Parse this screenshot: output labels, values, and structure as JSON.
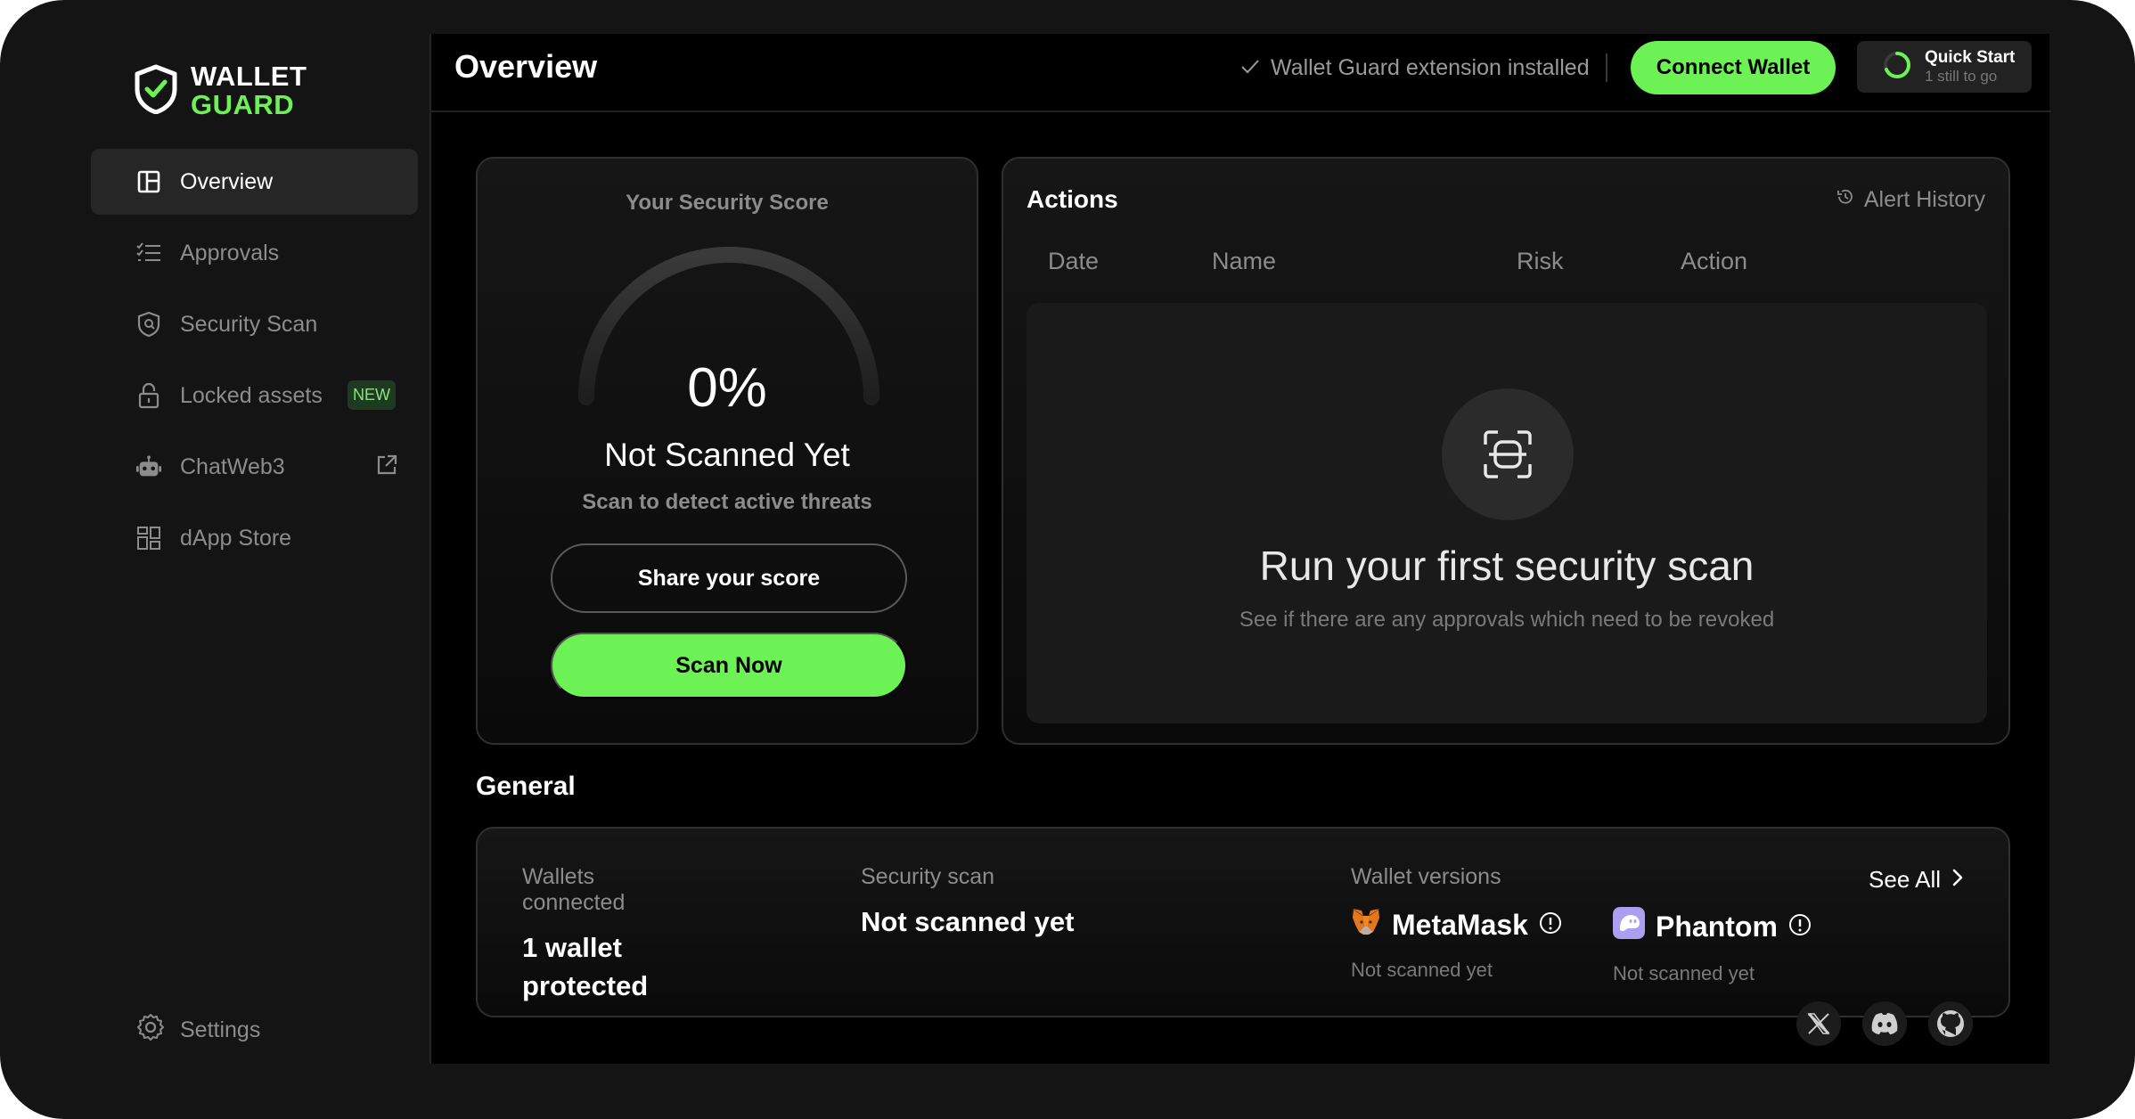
{
  "brand": {
    "line1": "WALLET",
    "line2": "GUARD"
  },
  "sidebar": {
    "items": [
      {
        "label": "Overview",
        "icon": "layout-icon",
        "active": true
      },
      {
        "label": "Approvals",
        "icon": "list-check-icon"
      },
      {
        "label": "Security Scan",
        "icon": "shield-scan-icon"
      },
      {
        "label": "Locked assets",
        "icon": "lock-icon",
        "badge": "NEW"
      },
      {
        "label": "ChatWeb3",
        "icon": "robot-icon",
        "external": true
      },
      {
        "label": "dApp Store",
        "icon": "grid-icon"
      }
    ],
    "settings_label": "Settings"
  },
  "header": {
    "title": "Overview",
    "extension_status": "Wallet Guard extension installed",
    "connect_label": "Connect Wallet",
    "quickstart": {
      "title": "Quick Start",
      "subtitle": "1 still to go"
    }
  },
  "score_card": {
    "label": "Your Security Score",
    "value": "0%",
    "status": "Not Scanned Yet",
    "hint": "Scan to detect active threats",
    "share_label": "Share your score",
    "scan_label": "Scan Now"
  },
  "actions_card": {
    "title": "Actions",
    "alert_history": "Alert History",
    "columns": [
      "Date",
      "Name",
      "Risk",
      "Action"
    ],
    "empty_title": "Run your first security scan",
    "empty_subtitle": "See if there are any approvals which need to be revoked"
  },
  "general": {
    "title": "General",
    "wallets_label": "Wallets connected",
    "wallets_value": "1 wallet protected",
    "scan_label": "Security scan",
    "scan_value": "Not scanned yet",
    "versions_label": "Wallet versions",
    "see_all": "See All",
    "wallets": [
      {
        "name": "MetaMask",
        "status": "Not scanned yet"
      },
      {
        "name": "Phantom",
        "status": "Not scanned yet"
      }
    ]
  },
  "colors": {
    "accent": "#6cf254",
    "background": "#000000",
    "frame": "#141414"
  },
  "socials": [
    "x-icon",
    "discord-icon",
    "github-icon"
  ]
}
